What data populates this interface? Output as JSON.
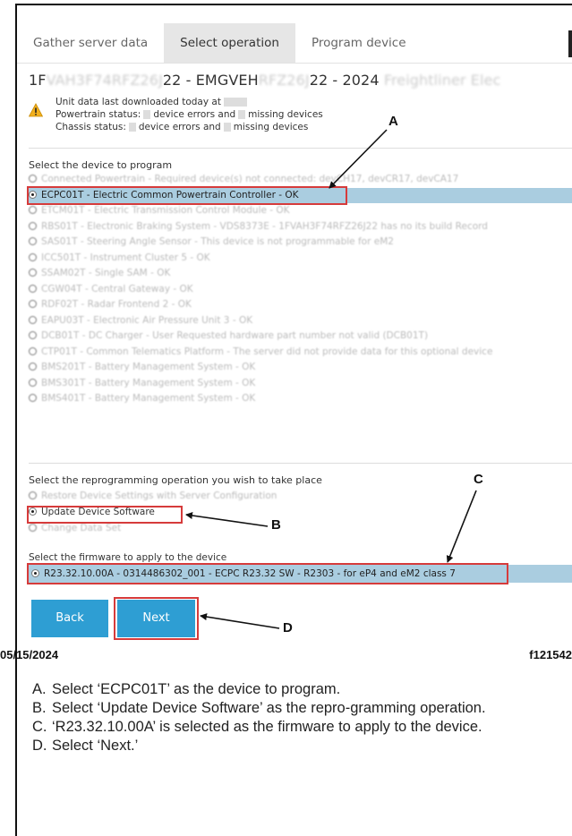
{
  "tabs": [
    {
      "label": "Gather server data"
    },
    {
      "label": "Select operation"
    },
    {
      "label": "Program device"
    }
  ],
  "header": {
    "unit_title_a": "1F",
    "unit_title_b": "22 - EMGVEH",
    "unit_title_c": "22 - 2024",
    "unit_title_blur1": "VAH3F74RFZ26J",
    "unit_title_blur2": "RFZ26J",
    "unit_title_blur3": "Freightliner Elec",
    "downloaded": "Unit data last downloaded today at",
    "powertrain_a": "Powertrain status:",
    "powertrain_b": "device errors and",
    "powertrain_c": "missing devices",
    "chassis_a": "Chassis status:",
    "chassis_b": "device errors and",
    "chassis_c": "missing devices"
  },
  "device_section_label": "Select the device to program",
  "devices": [
    {
      "label": "Connected Powertrain - Required device(s) not connected: devCH17, devCR17, devCA17",
      "state": "disabled"
    },
    {
      "label": "ECPC01T - Electric Common Powertrain Controller - OK",
      "state": "selected"
    },
    {
      "label": "ETCM01T - Electric Transmission Control Module - OK",
      "state": "faded"
    },
    {
      "label": "RBS01T - Electronic Braking System - VDS8373E - 1FVAH3F74RFZ26J22 has no its build Record",
      "state": "disabled"
    },
    {
      "label": "SAS01T - Steering Angle Sensor - This device is not programmable for eM2",
      "state": "disabled"
    },
    {
      "label": "ICC501T - Instrument Cluster 5 - OK",
      "state": "faded"
    },
    {
      "label": "SSAM02T - Single SAM - OK",
      "state": "faded"
    },
    {
      "label": "CGW04T - Central Gateway - OK",
      "state": "faded"
    },
    {
      "label": "RDF02T - Radar Frontend 2 - OK",
      "state": "faded"
    },
    {
      "label": "EAPU03T - Electronic Air Pressure Unit 3 - OK",
      "state": "faded"
    },
    {
      "label": "DCB01T - DC Charger - User Requested hardware part number not valid (DCB01T)",
      "state": "faded"
    },
    {
      "label": "CTP01T - Common Telematics Platform - The server did not provide data for this optional device",
      "state": "disabled"
    },
    {
      "label": "BMS201T - Battery Management System - OK",
      "state": "faded"
    },
    {
      "label": "BMS301T - Battery Management System - OK",
      "state": "faded"
    },
    {
      "label": "BMS401T - Battery Management System - OK",
      "state": "faded"
    }
  ],
  "op_section_label": "Select the reprogramming operation you wish to take place",
  "operations": [
    {
      "label": "Restore Device Settings with Server Configuration",
      "state": "faded"
    },
    {
      "label": "Update Device Software",
      "state": "selected"
    },
    {
      "label": "Change Data Set",
      "state": "faded"
    }
  ],
  "fw_section_label": "Select the firmware to apply to the device",
  "firmware": "R23.32.10.00A - 0314486302_001 - ECPC R23.32 SW - R2303 - for eP4 and eM2 class 7",
  "buttons": {
    "back": "Back",
    "next": "Next"
  },
  "callouts": {
    "a": "A",
    "b": "B",
    "c": "C",
    "d": "D"
  },
  "footer": {
    "date": "05/15/2024",
    "figure_id": "f121542"
  },
  "captions": [
    {
      "letter": "A.",
      "text": "Select ‘ECPC01T’ as the device to program."
    },
    {
      "letter": "B.",
      "text": "Select ‘Update Device Software’ as the repro-gramming operation."
    },
    {
      "letter": "C.",
      "text": "‘R23.32.10.00A’ is selected as the firmware to apply to the device."
    },
    {
      "letter": "D.",
      "text": "Select ‘Next.’"
    }
  ],
  "colors": {
    "accent": "#2e9ed3",
    "selection": "#aacde0",
    "highlight": "#d63b3b"
  }
}
